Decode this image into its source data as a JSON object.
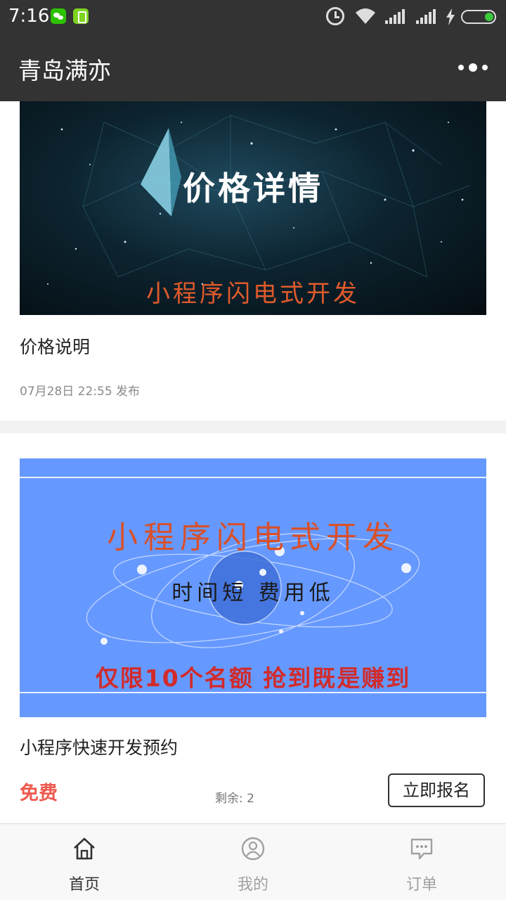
{
  "status_bar": {
    "time": "7:16",
    "icons": [
      "wechat-icon",
      "sim-icon",
      "alarm-icon",
      "wifi-icon",
      "signal-icon",
      "signal-icon",
      "charging-icon",
      "battery-icon"
    ]
  },
  "header": {
    "title": "青岛满亦",
    "menu_icon": "more-dots-icon"
  },
  "cards": [
    {
      "banner": {
        "headline": "价格详情",
        "subline": "小程序闪电式开发"
      },
      "title": "价格说明",
      "meta": "07月28日 22:55 发布"
    },
    {
      "banner": {
        "headline": "小程序闪电式开发",
        "middle": "时间短  费用低",
        "bottom": "仅限10个名额   抢到既是赚到"
      },
      "title": "小程序快速开发预约",
      "price": "免费",
      "remaining": "剩余: 2",
      "button": "立即报名"
    }
  ],
  "tabbar": {
    "items": [
      {
        "label": "首页",
        "icon": "home-icon",
        "active": true
      },
      {
        "label": "我的",
        "icon": "user-icon",
        "active": false
      },
      {
        "label": "订单",
        "icon": "message-icon",
        "active": false
      }
    ]
  },
  "colors": {
    "bar_background": "#333333",
    "accent_price": "#ee5a4f",
    "banner2_background": "#6699ff"
  }
}
